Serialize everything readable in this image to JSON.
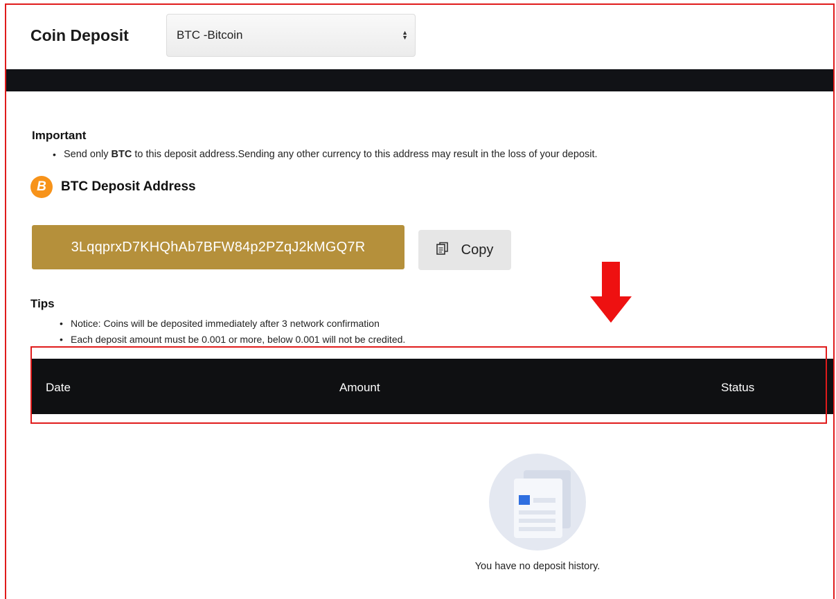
{
  "header": {
    "title": "Coin Deposit",
    "coin_select": {
      "selected": "BTC -Bitcoin"
    }
  },
  "important": {
    "heading": "Important",
    "notice_prefix": "Send only ",
    "notice_coin": "BTC",
    "notice_suffix": " to this deposit address.Sending any other currency to this address may result in the loss of your deposit."
  },
  "deposit": {
    "icon_letter": "B",
    "title": "BTC Deposit Address",
    "address": "3LqqprxD7KHQhAb7BFW84p2PZqJ2kMGQ7R",
    "copy_label": "Copy"
  },
  "tips": {
    "heading": "Tips",
    "items": [
      "Notice: Coins will be deposited immediately after 3 network confirmation",
      "Each deposit amount must be 0.001 or more, below 0.001 will not be credited."
    ]
  },
  "history_table": {
    "columns": [
      "Date",
      "Amount",
      "Status"
    ],
    "empty_message": "You have no deposit history."
  },
  "colors": {
    "annotation_red": "#e01b1b",
    "address_gold": "#b5903b",
    "bitcoin_orange": "#f7931a",
    "table_header_bg": "#0f1012"
  }
}
